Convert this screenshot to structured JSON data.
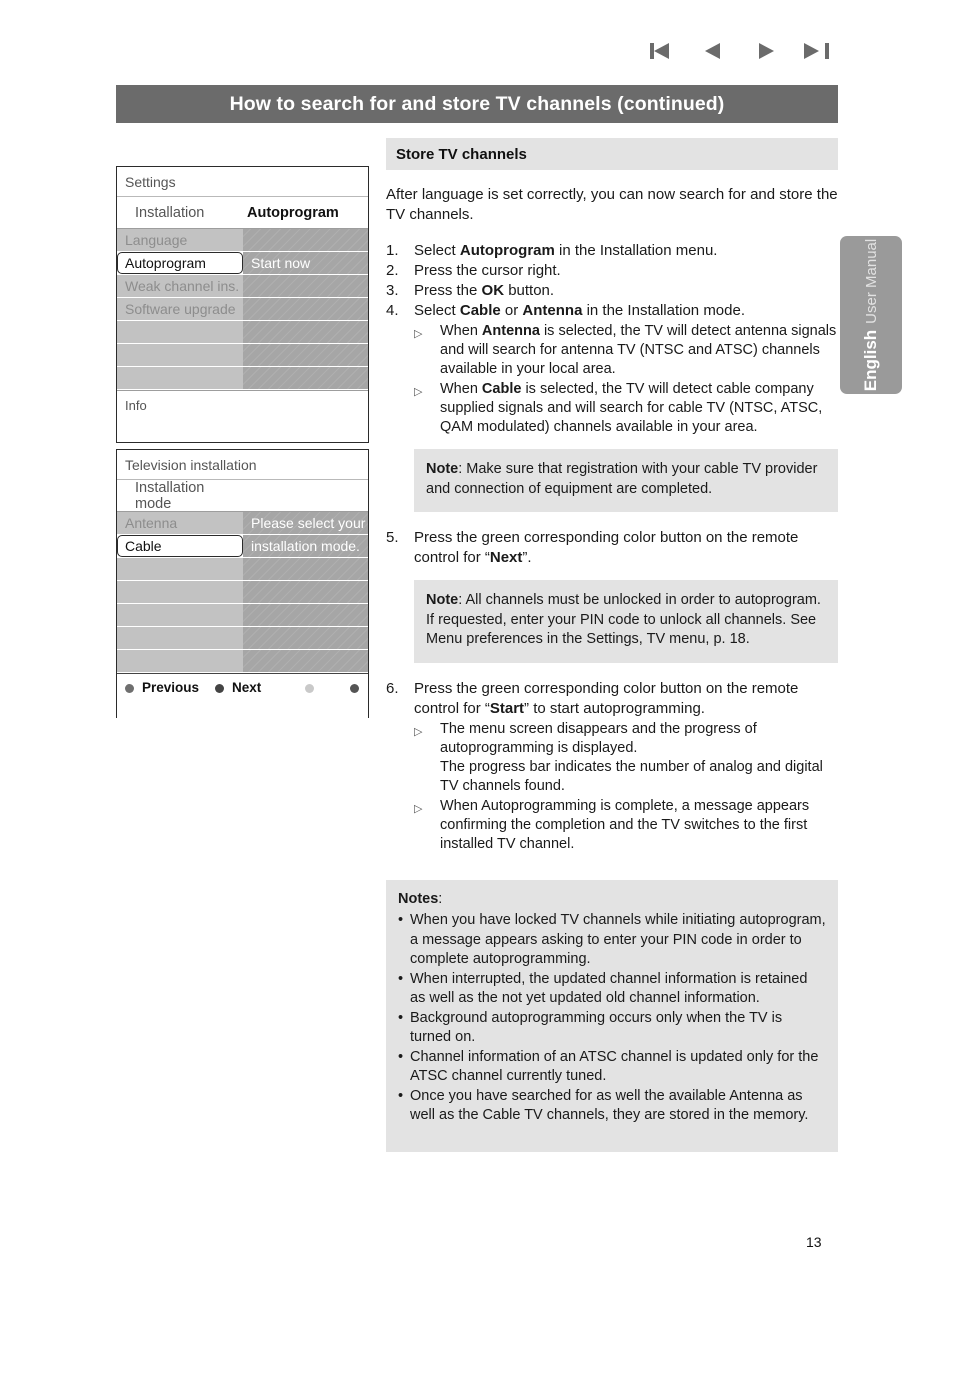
{
  "nav": {
    "first_label": "first-page",
    "prev_label": "previous-page",
    "next_label": "next-page",
    "last_label": "last-page"
  },
  "header": {
    "title": "How to search for and store TV channels (continued)",
    "bar_color": "#6b6b6b"
  },
  "side_tab": {
    "language": "English",
    "subtitle": "User Manual",
    "color": "#9a9a9a"
  },
  "menu_settings": {
    "title": "Settings",
    "sub_left": "Installation",
    "sub_right": "Autoprogram",
    "rows": [
      {
        "left": "Language",
        "right": "",
        "selected": false
      },
      {
        "left": "Autoprogram",
        "right": "Start now",
        "selected": true
      },
      {
        "left": "Weak channel ins.",
        "right": "",
        "selected": false
      },
      {
        "left": "Software upgrade",
        "right": "",
        "selected": false
      },
      {
        "left": "",
        "right": "",
        "selected": false
      },
      {
        "left": "",
        "right": "",
        "selected": false
      },
      {
        "left": "",
        "right": "",
        "selected": false
      }
    ],
    "info": "Info"
  },
  "menu_installation": {
    "title": "Television installation",
    "sub_left": "Installation mode",
    "sub_right": "",
    "rows": [
      {
        "left": "Antenna",
        "right": "Please select your",
        "selected": false
      },
      {
        "left": "Cable",
        "right": "installation mode.",
        "selected": true
      },
      {
        "left": "",
        "right": "",
        "selected": false
      },
      {
        "left": "",
        "right": "",
        "selected": false
      },
      {
        "left": "",
        "right": "",
        "selected": false
      },
      {
        "left": "",
        "right": "",
        "selected": false
      },
      {
        "left": "",
        "right": "",
        "selected": false
      }
    ],
    "footer": {
      "previous": "Previous",
      "next": "Next"
    }
  },
  "main": {
    "section_title": "Store TV channels",
    "intro": "After language is set correctly, you can now search for and store the TV channels.",
    "steps": [
      {
        "num": "1.",
        "text_parts": [
          {
            "t": "Select ",
            "b": false
          },
          {
            "t": "Autoprogram",
            "b": true
          },
          {
            "t": " in the Installation menu.",
            "b": false
          }
        ],
        "subs": []
      },
      {
        "num": "2.",
        "text_parts": [
          {
            "t": "Press the cursor right.",
            "b": false
          }
        ],
        "subs": []
      },
      {
        "num": "3.",
        "text_parts": [
          {
            "t": "Press the ",
            "b": false
          },
          {
            "t": "OK",
            "b": true
          },
          {
            "t": " button.",
            "b": false
          }
        ],
        "subs": []
      },
      {
        "num": "4.",
        "text_parts": [
          {
            "t": "Select ",
            "b": false
          },
          {
            "t": "Cable",
            "b": true
          },
          {
            "t": " or ",
            "b": false
          },
          {
            "t": "Antenna",
            "b": true
          },
          {
            "t": " in the Installation mode.",
            "b": false
          }
        ],
        "subs": [
          [
            {
              "t": "When ",
              "b": false
            },
            {
              "t": "Antenna",
              "b": true
            },
            {
              "t": " is selected, the TV will detect antenna signals and will search for antenna TV (NTSC and ATSC) channels available in your local area.",
              "b": false
            }
          ],
          [
            {
              "t": "When ",
              "b": false
            },
            {
              "t": "Cable",
              "b": true
            },
            {
              "t": " is selected, the TV will detect cable company supplied signals and will search for cable TV (NTSC, ATSC, QAM modulated) channels available in your area.",
              "b": false
            }
          ]
        ]
      }
    ],
    "note_1": [
      {
        "t": "Note",
        "b": true
      },
      {
        "t": ": Make sure that registration with your cable TV provider and connection of equipment are completed.",
        "b": false
      }
    ],
    "step_5": {
      "num": "5.",
      "text_parts": [
        {
          "t": "Press the green corresponding color button on the remote control for “",
          "b": false
        },
        {
          "t": "Next",
          "b": true
        },
        {
          "t": "”.",
          "b": false
        }
      ]
    },
    "note_2": [
      {
        "t": "Note",
        "b": true
      },
      {
        "t": ": All channels must be unlocked in order to autoprogram. If requested, enter your PIN code to unlock all channels. See Menu preferences in the Settings, TV menu, p. 18.",
        "b": false
      }
    ],
    "step_6": {
      "num": "6.",
      "text_parts": [
        {
          "t": "Press the green corresponding color button on the remote control for “",
          "b": false
        },
        {
          "t": "Start",
          "b": true
        },
        {
          "t": "” to start autoprogramming.",
          "b": false
        }
      ],
      "subs": [
        [
          {
            "t": "The menu screen disappears and the progress of autoprogramming is displayed.\nThe progress bar indicates the number of analog and digital TV channels found.",
            "b": false
          }
        ],
        [
          {
            "t": "When Autoprogramming is complete, a message appears confirming the completion and the TV switches to the first installed TV channel.",
            "b": false
          }
        ]
      ]
    },
    "notes_block": {
      "title": "Notes",
      "title_colon": ":",
      "items": [
        "When you have locked TV channels while initiating autoprogram, a message appears asking to enter your PIN code in order to complete autoprogramming.",
        "When interrupted, the updated channel information is retained as well as the not yet updated old channel information.",
        "Background autoprogramming occurs only when the TV is turned on.",
        "Channel information of an ATSC channel is updated only for the ATSC channel currently tuned.",
        "Once you have searched for as well the available Antenna as well as the Cable TV channels, they are stored in the memory."
      ]
    }
  },
  "footer": {
    "page_number": "13"
  }
}
